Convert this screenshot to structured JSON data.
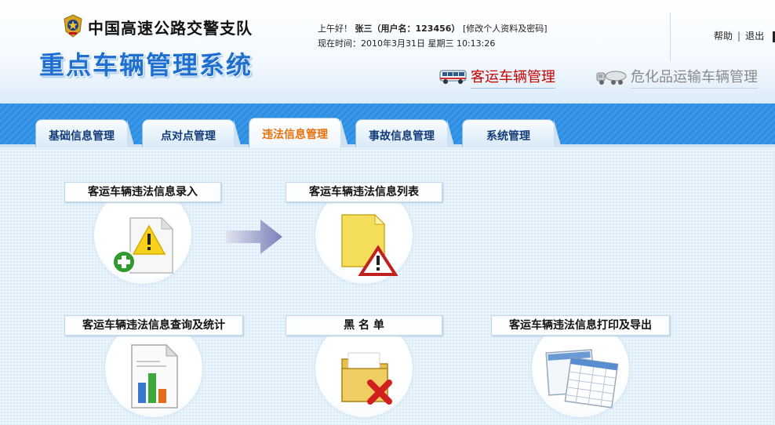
{
  "header": {
    "org_name": "中国高速公路交警支队",
    "system_title": "重点车辆管理系统",
    "greeting_prefix": "上午好！",
    "user_display": "张三（用户名：123456）",
    "edit_profile": "[修改个人资料及密码]",
    "time_label": "现在时间：2010年3月31日 星期三 10:13:26",
    "help": "帮助",
    "logout": "退出",
    "separator": "|"
  },
  "modules": {
    "passenger": "客运车辆管理",
    "hazmat": "危化品运输车辆管理"
  },
  "nav": {
    "tabs": [
      {
        "label": "基础信息管理"
      },
      {
        "label": "点对点管理"
      },
      {
        "label": "违法信息管理"
      },
      {
        "label": "事故信息管理"
      },
      {
        "label": "系统管理"
      }
    ],
    "active_tab": "违法信息管理"
  },
  "functions": {
    "entry": "客运车辆违法信息录入",
    "list": "客运车辆违法信息列表",
    "query": "客运车辆违法信息查询及统计",
    "blacklist": "黑 名 单",
    "print": "客运车辆违法信息打印及导出"
  },
  "icons": {
    "emblem": "police-emblem-icon",
    "bus": "bus-icon",
    "tanker": "tanker-truck-icon",
    "entry": "add-warning-document-icon",
    "list": "warning-file-icon",
    "query": "bar-chart-document-icon",
    "blacklist": "folder-delete-icon",
    "print": "spreadsheet-export-icon",
    "arrow": "right-arrow-icon"
  },
  "colors": {
    "title_blue": "#1e6fd0",
    "active_tab": "#e8710a",
    "passenger_module": "#c80000",
    "hazmat_module": "#8a8a8a",
    "nav_bar": "#2e8de0"
  }
}
